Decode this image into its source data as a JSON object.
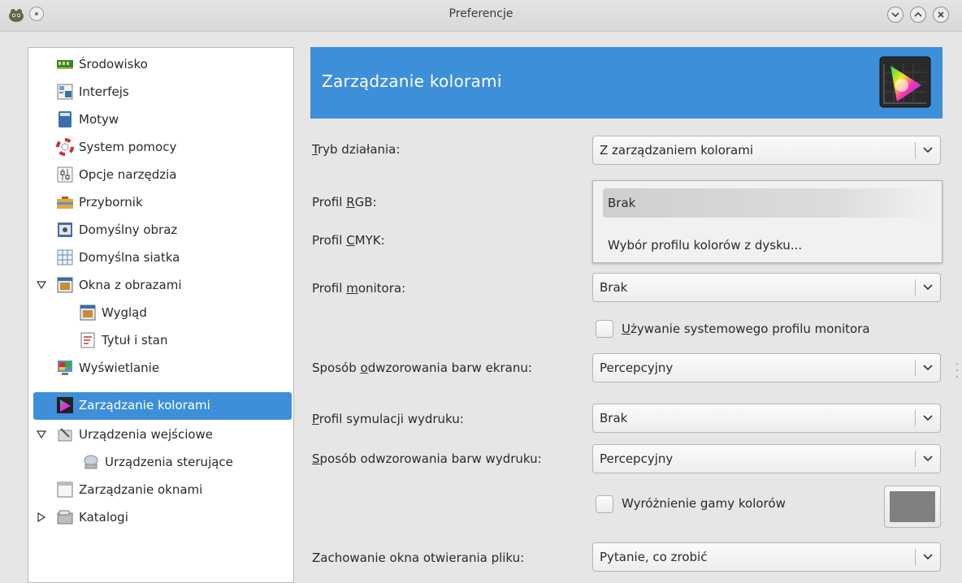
{
  "window": {
    "title": "Preferencje"
  },
  "sidebar": {
    "items": [
      {
        "label": "Środowisko",
        "icon": "memory-chip-icon"
      },
      {
        "label": "Interfejs",
        "icon": "interface-icon"
      },
      {
        "label": "Motyw",
        "icon": "theme-icon"
      },
      {
        "label": "System pomocy",
        "icon": "lifebuoy-icon"
      },
      {
        "label": "Opcje narzędzia",
        "icon": "tool-options-icon"
      },
      {
        "label": "Przybornik",
        "icon": "toolbox-icon"
      },
      {
        "label": "Domyślny obraz",
        "icon": "default-image-icon"
      },
      {
        "label": "Domyślna siatka",
        "icon": "grid-icon"
      },
      {
        "label": "Okna z obrazami",
        "icon": "image-windows-icon",
        "expanded": true
      },
      {
        "label": "Wygląd",
        "icon": "appearance-icon"
      },
      {
        "label": "Tytuł i stan",
        "icon": "title-status-icon"
      },
      {
        "label": "Wyświetlanie",
        "icon": "display-icon"
      },
      {
        "label": "Zarządzanie kolorami",
        "icon": "color-management-icon",
        "selected": true
      },
      {
        "label": "Urządzenia wejściowe",
        "icon": "input-devices-icon",
        "expanded": true
      },
      {
        "label": "Urządzenia sterujące",
        "icon": "controllers-icon"
      },
      {
        "label": "Zarządzanie oknami",
        "icon": "window-management-icon"
      },
      {
        "label": "Katalogi",
        "icon": "folders-icon",
        "expanded": false
      }
    ]
  },
  "page": {
    "title": "Zarządzanie kolorami",
    "mode": {
      "label_u": "T",
      "label_rest": "ryb działania:",
      "value": "Z zarządzaniem kolorami"
    },
    "rgb_profile": {
      "label_pre": "Profil ",
      "label_u": "R",
      "label_rest": "GB:"
    },
    "cmyk_profile": {
      "label_pre": "Profil ",
      "label_u": "C",
      "label_rest": "MYK:"
    },
    "dropdown_options": [
      "Brak",
      "Wybór profilu kolorów z dysku..."
    ],
    "monitor_profile": {
      "label_pre": "Profil ",
      "label_u": "m",
      "label_rest": "onitora:",
      "value": "Brak"
    },
    "system_monitor_profile": {
      "label_u": "U",
      "label_rest": "żywanie systemowego profilu monitora",
      "checked": false
    },
    "display_intent": {
      "label_pre": "Sposób ",
      "label_u": "o",
      "label_rest": "dwzorowania barw ekranu:",
      "value": "Percepcyjny"
    },
    "print_sim_profile": {
      "label_u": "P",
      "label_rest": "rofil symulacji wydruku:",
      "value": "Brak"
    },
    "print_intent": {
      "label_u": "S",
      "label_rest": "posób odwzorowania barw wydruku:",
      "value": "Percepcyjny"
    },
    "gamut_check": {
      "label": "Wyróżnienie gamy kolorów",
      "checked": false,
      "color": "#808080"
    },
    "file_open_behaviour": {
      "label": "Zachowanie okna otwierania pliku:",
      "value": "Pytanie, co zrobić"
    }
  },
  "colors": {
    "accent": "#3d8fd9",
    "gamut_swatch": "#808080"
  }
}
